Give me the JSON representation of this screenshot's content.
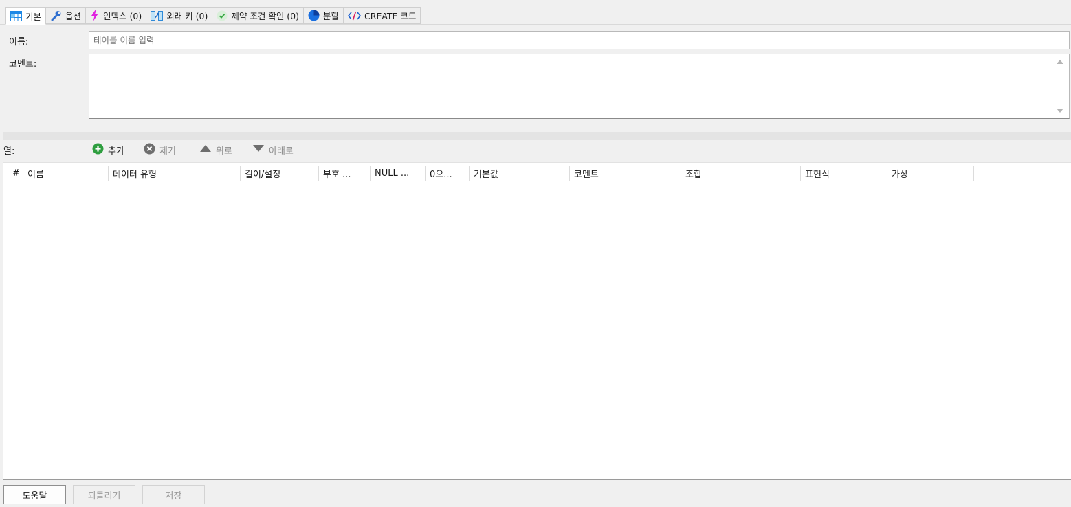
{
  "tabs": [
    {
      "label": "기본",
      "icon": "table-icon"
    },
    {
      "label": "옵션",
      "icon": "wrench-icon"
    },
    {
      "label": "인덱스 (0)",
      "icon": "lightning-icon"
    },
    {
      "label": "외래 키 (0)",
      "icon": "foreign-key-icon"
    },
    {
      "label": "제약 조건 확인 (0)",
      "icon": "check-icon"
    },
    {
      "label": "분할",
      "icon": "pie-icon"
    },
    {
      "label": "CREATE 코드",
      "icon": "code-icon"
    }
  ],
  "form": {
    "name_label": "이름:",
    "name_placeholder": "테이블 이름 입력",
    "comment_label": "코멘트:"
  },
  "columns_toolbar": {
    "label": "열:",
    "add": "추가",
    "remove": "제거",
    "up": "위로",
    "down": "아래로"
  },
  "grid": {
    "headers": [
      "#",
      "이름",
      "데이터 유형",
      "길이/설정",
      "부호 ...",
      "NULL ...",
      "0으...",
      "기본값",
      "코멘트",
      "조합",
      "표현식",
      "가상"
    ]
  },
  "buttons": {
    "help": "도움말",
    "revert": "되돌리기",
    "save": "저장"
  },
  "colors": {
    "add_green": "#2e9e3f",
    "lightning_magenta": "#e020e0",
    "pie_blue": "#1a6fe0",
    "code_blue": "#1a5fd0",
    "table_blue": "#1e88e5",
    "check_green": "#39a845"
  }
}
